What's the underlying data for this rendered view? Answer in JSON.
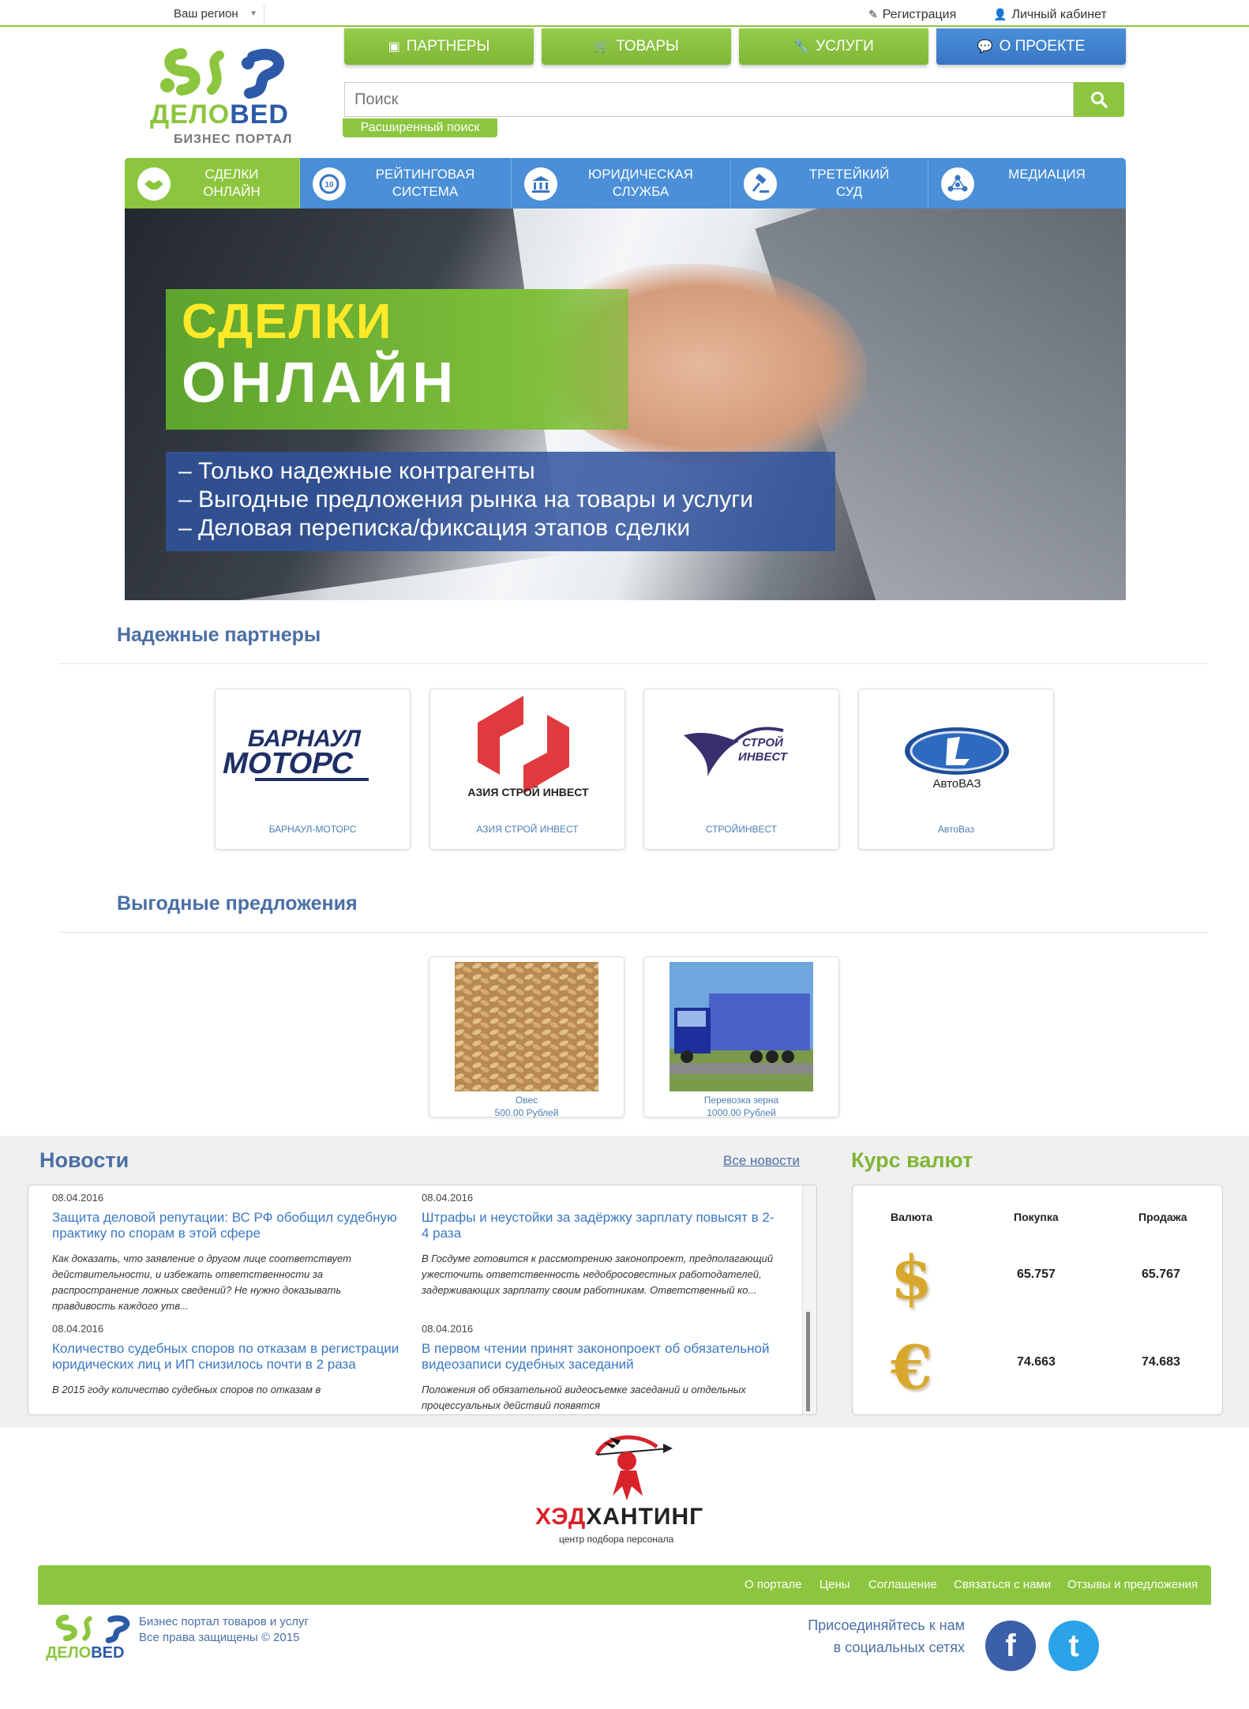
{
  "topbar": {
    "region_label": "Ваш регион",
    "register_label": "Регистрация",
    "cabinet_label": "Личный кабинет"
  },
  "logo": {
    "word_a": "ДЕЛО",
    "word_b": "ВЕD",
    "subtitle": "БИЗНЕС ПОРТАЛ"
  },
  "nav": [
    {
      "label": "ПАРТНЕРЫ",
      "icon": "briefcase-icon"
    },
    {
      "label": "ТОВАРЫ",
      "icon": "cart-icon"
    },
    {
      "label": "УСЛУГИ",
      "icon": "wrench-icon"
    },
    {
      "label": "О ПРОЕКТЕ",
      "icon": "comment-icon"
    }
  ],
  "search": {
    "placeholder": "Поиск",
    "advanced_label": "Расширенный поиск"
  },
  "tabs": [
    {
      "line1": "Сделки",
      "line2": "онлайн",
      "icon": "handshake-icon"
    },
    {
      "line1": "Рейтинговая",
      "line2": "система",
      "icon": "rating-icon"
    },
    {
      "line1": "Юридическая",
      "line2": "служба",
      "icon": "bank-icon"
    },
    {
      "line1": "Третейкий",
      "line2": "суд",
      "icon": "gavel-icon"
    },
    {
      "line1": "Медиация",
      "line2": "",
      "icon": "network-icon"
    }
  ],
  "banner": {
    "title1": "СДЕЛКИ",
    "title2": "ОНЛАЙН",
    "lines": [
      "– Только надежные контрагенты",
      "– Выгодные предложения рынка на товары и услуги",
      "– Деловая переписка/фиксация этапов сделки"
    ]
  },
  "partners": {
    "title": "Надежные партнеры",
    "items": [
      {
        "caption": "БАРНАУЛ-МОТОРС",
        "logo_top": "БАРНАУЛ",
        "logo_bottom": "МОТОРС"
      },
      {
        "caption": "АЗИЯ СТРОЙ ИНВЕСТ",
        "logo_text": "АЗИЯ СТРОЙ ИНВЕСТ"
      },
      {
        "caption": "СТРОЙИНВЕСТ",
        "logo_top": "СТРОЙ",
        "logo_bottom": "ИНВЕСТ"
      },
      {
        "caption": "АвтоВаз",
        "logo_text": "АвтоВАЗ"
      }
    ]
  },
  "offers": {
    "title": "Выгодные предложения",
    "items": [
      {
        "name": "Овес",
        "price": "500.00 Рублей"
      },
      {
        "name": "Перевозка зерна",
        "price": "1000.00 Рублей"
      }
    ]
  },
  "news": {
    "title": "Новости",
    "all_label": "Все новости",
    "items": [
      {
        "date": "08.04.2016",
        "headline": "Защита деловой репутации: ВС РФ обобщил судебную практику по спорам в этой сфере",
        "text": "Как доказать, что заявление о другом лице соответствует действительности, и избежать ответственности за распространение ложных сведений? Не нужно доказывать правдивость каждого утв..."
      },
      {
        "date": "08.04.2016",
        "headline": "Штрафы и неустойки за задёржку зарплату повысят в 2-4 раза",
        "text": "В Госдуме готовится к рассмотрению законопроект, предполагающий ужесточить ответственность недобросовестных работодателей, задерживающих зарплату своим работникам. Ответственный ко..."
      },
      {
        "date": "08.04.2016",
        "headline": "Количество судебных споров по отказам в регистрации юридических лиц и ИП снизилось почти в 2 раза",
        "text": "В 2015 году количество судебных споров по отказам в"
      },
      {
        "date": "08.04.2016",
        "headline": "В первом чтении принят законопроект об обязательной видеозаписи судебных заседаний",
        "text": "Положения об обязательной видеосъемке заседаний и отдельных процессуальных действий появятся"
      }
    ]
  },
  "currency": {
    "title": "Курс валют",
    "col_currency": "Валюта",
    "col_buy": "Покупка",
    "col_sell": "Продажа",
    "rows": [
      {
        "symbol": "$",
        "icon": "dollar-icon",
        "buy": "65.757",
        "sell": "65.767"
      },
      {
        "symbol": "€",
        "icon": "euro-icon",
        "buy": "74.663",
        "sell": "74.683"
      }
    ]
  },
  "sponsor": {
    "word_a": "ХЭД",
    "word_b": "ХАНТИНГ",
    "subtitle": "центр подбора персонала"
  },
  "footer": {
    "links": [
      "О портале",
      "Цены",
      "Соглашение",
      "Связаться с нами",
      "Отзывы и предложения"
    ],
    "copy1": "Бизнес портал товаров и услуг",
    "copy2": "Все права защищены © 2015",
    "social1": "Присоединяйтесь к нам",
    "social2": "в социальных сетях",
    "facebook_glyph": "f",
    "twitter_glyph": "t"
  },
  "colors": {
    "green": "#8cc63f",
    "blue": "#3876c4",
    "title_blue": "#4a6fa5",
    "title_green": "#7fb636"
  }
}
